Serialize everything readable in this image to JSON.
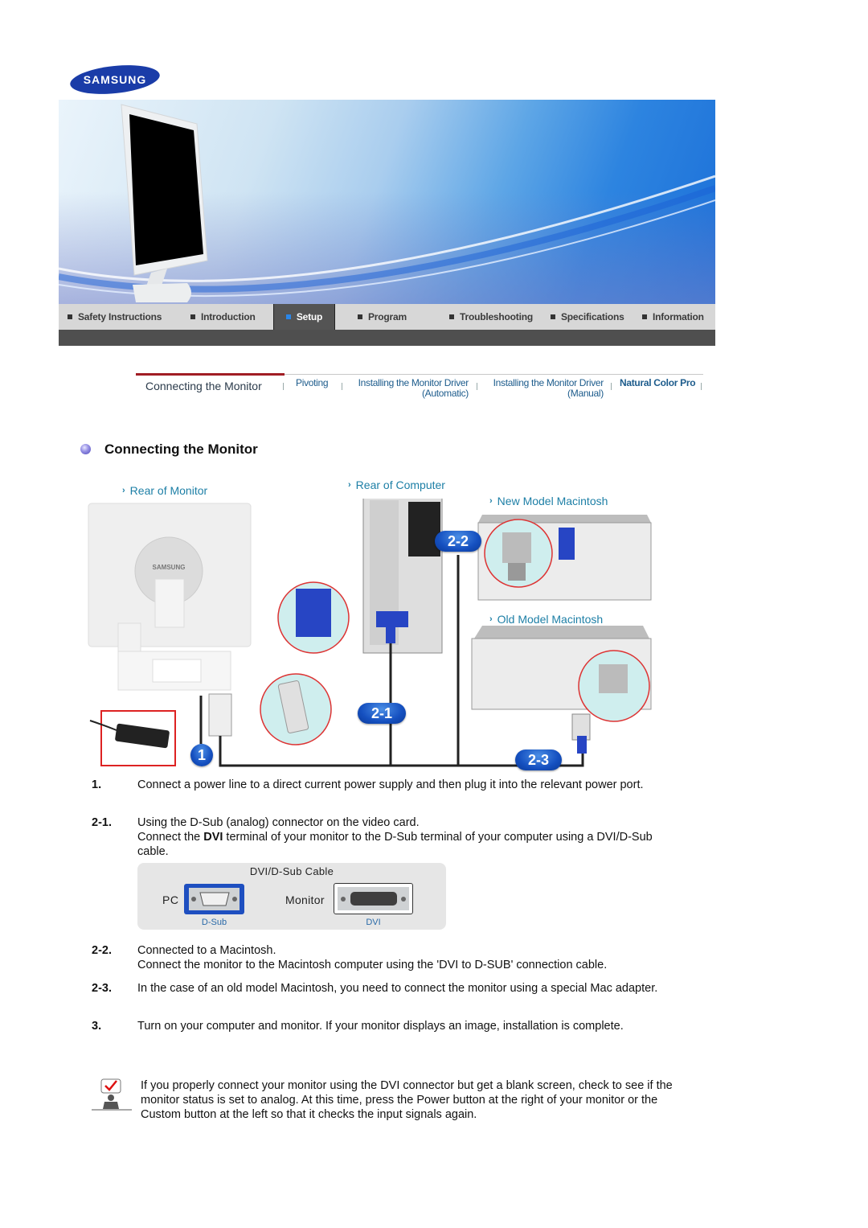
{
  "brand": {
    "logo_text": "SAMSUNG",
    "color": "#1428a0"
  },
  "top_nav": {
    "items": [
      {
        "label": "Safety Instructions",
        "active": false
      },
      {
        "label": "Introduction",
        "active": false
      },
      {
        "label": "Setup",
        "active": true
      },
      {
        "label": "Program",
        "active": false
      },
      {
        "label": "Troubleshooting",
        "active": false
      },
      {
        "label": "Specifications",
        "active": false
      },
      {
        "label": "Information",
        "active": false
      }
    ]
  },
  "sub_nav": {
    "items": [
      {
        "label": "Connecting the Monitor",
        "active": true
      },
      {
        "label": "Pivoting",
        "active": false
      },
      {
        "label": "Installing the Monitor Driver",
        "sub": "(Automatic)",
        "active": false
      },
      {
        "label": "Installing the Monitor Driver",
        "sub": "(Manual)",
        "active": false
      },
      {
        "label": "Natural Color Pro",
        "active": false
      }
    ]
  },
  "section": {
    "title": "Connecting the Monitor"
  },
  "diagram": {
    "labels": {
      "rear_monitor": "Rear of Monitor",
      "rear_computer": "Rear of Computer",
      "new_mac": "New Model Macintosh",
      "old_mac": "Old Model Macintosh"
    },
    "badges": {
      "b1": "1",
      "b21": "2-1",
      "b22": "2-2",
      "b23": "2-3"
    },
    "monitor_brand": "SAMSUNG"
  },
  "steps": [
    {
      "num": "1.",
      "lines": [
        "Connect a power line to a direct current power supply and then plug it into the relevant power port."
      ]
    },
    {
      "num": "2-1.",
      "line1": "Using the D-Sub (analog) connector on the video card.",
      "line2_pre": "Connect the ",
      "line2_bold": "DVI",
      "line2_post": " terminal of your monitor to the D-Sub terminal of your computer using a DVI/D-Sub cable."
    },
    {
      "num": "2-2.",
      "line1": "Connected to a Macintosh.",
      "line2": "Connect the monitor to the Macintosh computer using the 'DVI to D-SUB' connection cable."
    },
    {
      "num": "2-3.",
      "lines": [
        "In the case of an old model Macintosh, you need to connect the monitor using a special Mac adapter."
      ]
    },
    {
      "num": "3.",
      "lines": [
        "Turn on your computer and monitor. If your monitor displays an image, installation is complete."
      ]
    }
  ],
  "cable": {
    "title": "DVI/D-Sub Cable",
    "pc_label": "PC",
    "monitor_label": "Monitor",
    "dsub_label": "D-Sub",
    "dvi_label": "DVI"
  },
  "note": {
    "text": "If you properly connect your monitor using the DVI connector but get a blank screen, check to see if the monitor status is set to analog. At this time, press the Power button at the right of your monitor or the Custom button at the left so that it checks the input signals again."
  }
}
